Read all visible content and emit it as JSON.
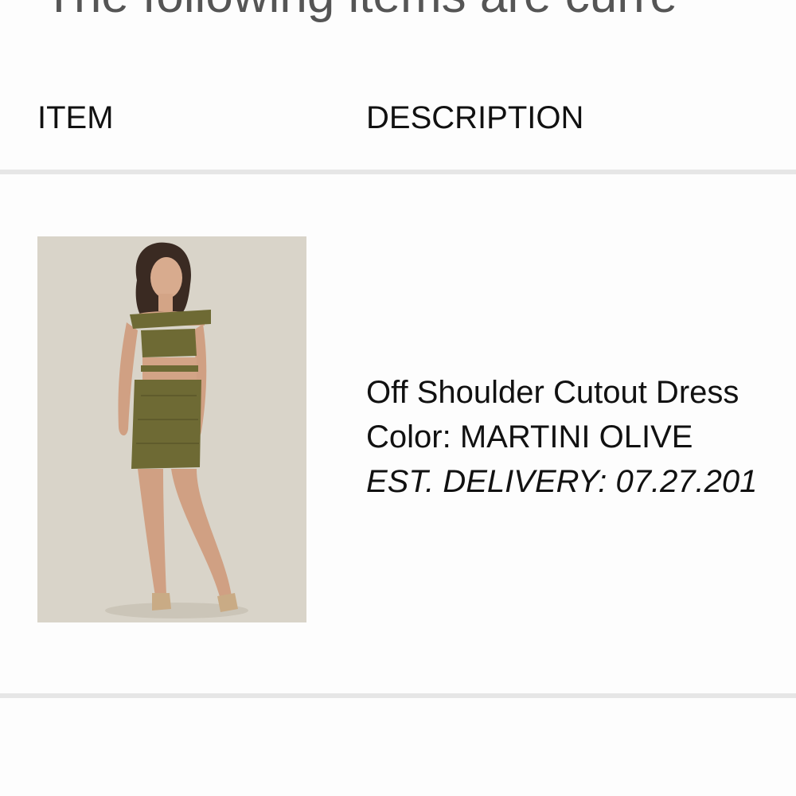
{
  "intro": {
    "text": "The following items are curre"
  },
  "table": {
    "headers": {
      "item": "ITEM",
      "description": "DESCRIPTION"
    },
    "rows": [
      {
        "product_name": "Off Shoulder Cutout Dress",
        "color_line": "Color: MARTINI OLIVE",
        "delivery_line": "EST. DELIVERY: 07.27.201",
        "image_alt": "Off Shoulder Cutout Dress"
      }
    ]
  },
  "colors": {
    "divider": "#e6e6e6",
    "image_background": "#d9d4c9",
    "dress": "#6e6a34"
  }
}
